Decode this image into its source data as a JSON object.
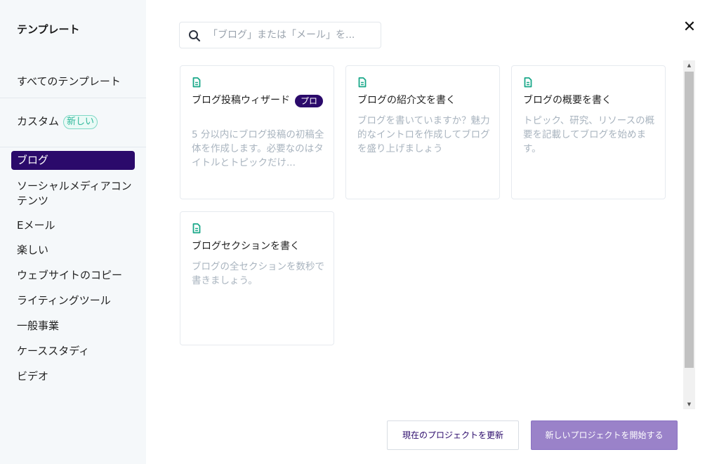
{
  "sidebar": {
    "title": "テンプレート",
    "items": [
      {
        "label": "すべてのテンプレート"
      },
      {
        "label": "カスタム",
        "badge": "新しい"
      },
      {
        "label": "ブログ",
        "active": true
      },
      {
        "label": "ソーシャルメディアコンテンツ"
      },
      {
        "label": "Eメール"
      },
      {
        "label": "楽しい"
      },
      {
        "label": "ウェブサイトのコピー"
      },
      {
        "label": "ライティングツール"
      },
      {
        "label": "一般事業"
      },
      {
        "label": "ケーススタディ"
      },
      {
        "label": "ビデオ"
      }
    ]
  },
  "search": {
    "placeholder": "「ブログ」または「メール」を..."
  },
  "close": {
    "icon": "close-icon",
    "symbol": "✕"
  },
  "cards": [
    {
      "title": "ブログ投稿ウィザード",
      "badge": "プロ",
      "description": "5 分以内にブログ投稿の初稿全体を作成します。必要なのはタイトルとトピックだけ..."
    },
    {
      "title": "ブログの紹介文を書く",
      "description": "ブログを書いていますか？魅力的なイントロを作成してブログを盛り上げましょう"
    },
    {
      "title": "ブログの概要を書く",
      "description": "トピック、研究、リソースの概要を記載してブログを始めます。"
    },
    {
      "title": "ブログセクションを書く",
      "description": "ブログの全セクションを数秒で書きましょう。"
    }
  ],
  "footer": {
    "update_label": "現在のプロジェクトを更新",
    "new_label": "新しいプロジェクトを開始する"
  },
  "colors": {
    "accent": "#2b0a6b",
    "icon_green": "#1aa889",
    "primary_button": "#9a82c9"
  }
}
